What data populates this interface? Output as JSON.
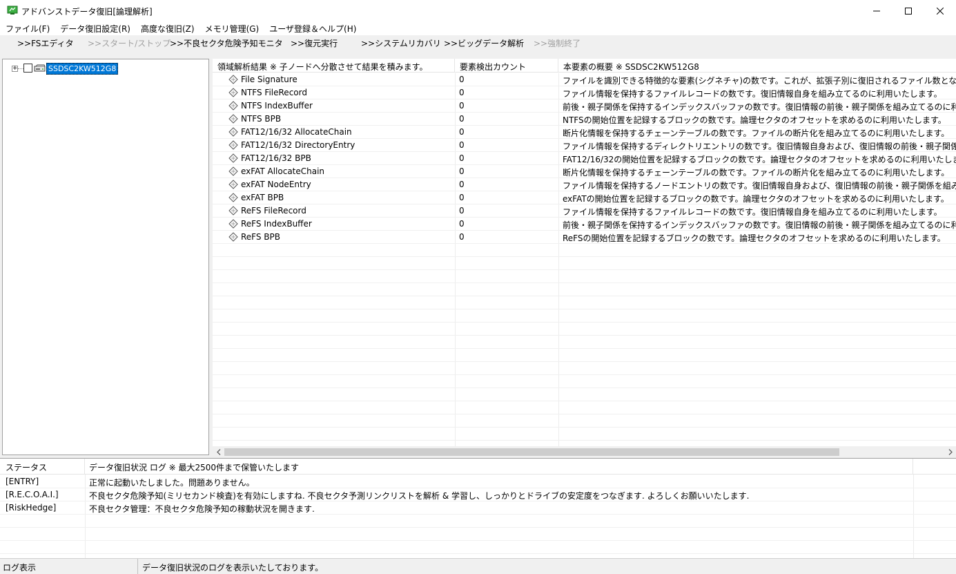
{
  "window": {
    "title": "アドバンストデータ復旧[論理解析]"
  },
  "menu": [
    "ファイル(F)",
    "データ復旧設定(R)",
    "高度な復旧(Z)",
    "メモリ管理(G)",
    "ユーザ登録＆ヘルプ(H)"
  ],
  "toolbar": [
    {
      "label": ">>FSエディタ",
      "enabled": true
    },
    {
      "label": ">>スタート/ストップ",
      "enabled": false
    },
    {
      "label": ">>不良セクタ危険予知モニタ",
      "enabled": true
    },
    {
      "label": ">>復元実行",
      "enabled": true
    },
    {
      "label": ">>システムリカバリ",
      "enabled": true
    },
    {
      "label": ">>ビッグデータ解析",
      "enabled": true
    },
    {
      "label": ">>強制終了",
      "enabled": false
    }
  ],
  "tree": {
    "expander": "+",
    "drive_label": "SSDSC2KW512G8"
  },
  "list": {
    "headers": [
      "領域解析結果 ※ 子ノードへ分散させて結果を積みます。",
      "要素検出カウント",
      "本要素の概要 ※ SSDSC2KW512G8"
    ],
    "rows": [
      {
        "name": "File Signature",
        "count": "0",
        "desc": "ファイルを識別できる特徴的な要素(シグネチャ)の数です。これが、拡張子別に復旧されるファイル数となります。"
      },
      {
        "name": "NTFS FileRecord",
        "count": "0",
        "desc": "ファイル情報を保持するファイルレコードの数です。復旧情報自身を組み立てるのに利用いたします。"
      },
      {
        "name": "NTFS IndexBuffer",
        "count": "0",
        "desc": "前後・親子関係を保持するインデックスバッファの数です。復旧情報の前後・親子関係を組み立てるのに利用いたします。"
      },
      {
        "name": "NTFS BPB",
        "count": "0",
        "desc": "NTFSの開始位置を記録するブロックの数です。論理セクタのオフセットを求めるのに利用いたします。"
      },
      {
        "name": "FAT12/16/32 AllocateChain",
        "count": "0",
        "desc": "断片化情報を保持するチェーンテーブルの数です。ファイルの断片化を組み立てるのに利用いたします。"
      },
      {
        "name": "FAT12/16/32 DirectoryEntry",
        "count": "0",
        "desc": "ファイル情報を保持するディレクトリエントリの数です。復旧情報自身および、復旧情報の前後・親子関係を組み立てるのに利用いたします。"
      },
      {
        "name": "FAT12/16/32 BPB",
        "count": "0",
        "desc": "FAT12/16/32の開始位置を記録するブロックの数です。論理セクタのオフセットを求めるのに利用いたします。"
      },
      {
        "name": "exFAT AllocateChain",
        "count": "0",
        "desc": "断片化情報を保持するチェーンテーブルの数です。ファイルの断片化を組み立てるのに利用いたします。"
      },
      {
        "name": "exFAT NodeEntry",
        "count": "0",
        "desc": "ファイル情報を保持するノードエントリの数です。復旧情報自身および、復旧情報の前後・親子関係を組み立てるのに利用いたします。"
      },
      {
        "name": "exFAT BPB",
        "count": "0",
        "desc": "exFATの開始位置を記録するブロックの数です。論理セクタのオフセットを求めるのに利用いたします。"
      },
      {
        "name": "ReFS FileRecord",
        "count": "0",
        "desc": "ファイル情報を保持するファイルレコードの数です。復旧情報自身を組み立てるのに利用いたします。"
      },
      {
        "name": "ReFS IndexBuffer",
        "count": "0",
        "desc": "前後・親子関係を保持するインデックスバッファの数です。復旧情報の前後・親子関係を組み立てるのに利用いたします。"
      },
      {
        "name": "ReFS BPB",
        "count": "0",
        "desc": "ReFSの開始位置を記録するブロックの数です。論理セクタのオフセットを求めるのに利用いたします。"
      }
    ]
  },
  "log": {
    "headers": [
      "ステータス",
      "データ復旧状況 ログ ※ 最大2500件まで保管いたします"
    ],
    "rows": [
      {
        "status": "[ENTRY]",
        "message": "正常に起動いたしました。問題ありません。"
      },
      {
        "status": "[R.E.C.O.A.I.]",
        "message": "不良セクタ危険予知(ミリセカンド検査)を有効にしますね. 不良セクタ予測リンクリストを解析 & 学習し、しっかりとドライブの安定度をつなぎます. よろしくお願いいたします."
      },
      {
        "status": "[RiskHedge]",
        "message": "不良セクタ管理：不良セクタ危険予知の稼動状況を開きます."
      }
    ]
  },
  "statusbar": {
    "left": "ログ表示",
    "right": "データ復旧状況のログを表示いたしております。"
  },
  "colors": {
    "selection": "#0078d7",
    "disabled_text": "#a0a0a0",
    "toolbar_bg": "#f0f0f0"
  }
}
